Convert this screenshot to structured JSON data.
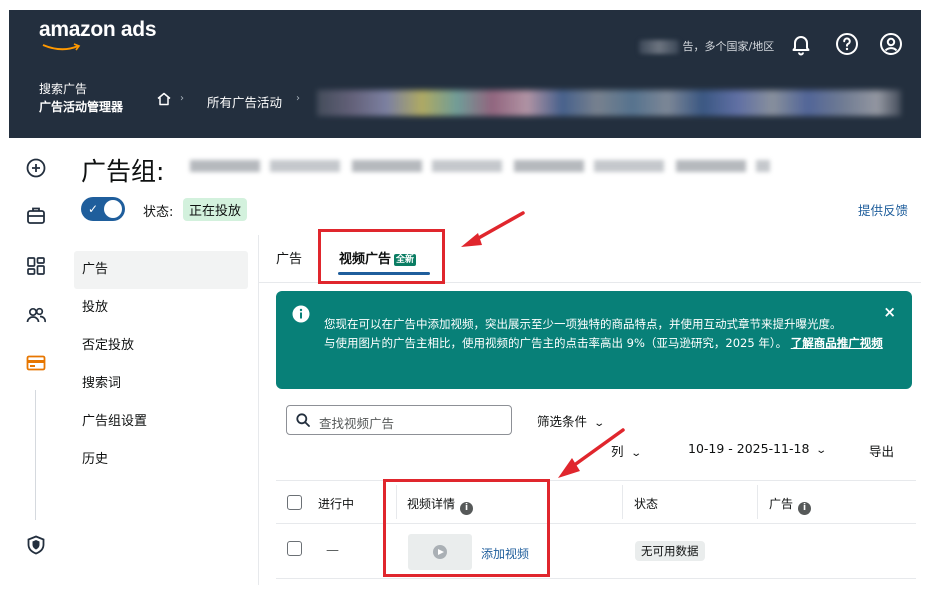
{
  "header": {
    "logo_text": "amazon ads",
    "account_text": "告，多个国家/地区",
    "breadcrumb_left_line1": "搜索广告",
    "breadcrumb_left_line2": "广告活动管理器",
    "breadcrumb_all_campaigns": "所有广告活动",
    "separator": "›",
    "icons": [
      "bell-icon",
      "help-icon",
      "user-icon",
      "home-icon"
    ]
  },
  "rail": {
    "icons": [
      "plus-circle-icon",
      "briefcase-icon",
      "dashboard-icon",
      "users-icon",
      "billing-card-icon",
      "shield-icon"
    ],
    "active_color": "#e77600"
  },
  "page": {
    "title": "广告组:",
    "status_label": "状态:",
    "status_value": "正在投放",
    "toggle_check": "✓",
    "feedback_link": "提供反馈"
  },
  "section_nav": {
    "items": [
      {
        "label": "广告",
        "active": true
      },
      {
        "label": "投放",
        "active": false
      },
      {
        "label": "否定投放",
        "active": false
      },
      {
        "label": "搜索词",
        "active": false
      },
      {
        "label": "广告组设置",
        "active": false
      },
      {
        "label": "历史",
        "active": false
      }
    ]
  },
  "tabs": {
    "ads": "广告",
    "video_ads": "视频广告",
    "new_badge": "全新"
  },
  "banner": {
    "text_line1": "您现在可以在广告中添加视频，突出展示至少一项独特的商品特点，并使用互动式章节来提升曝光度。",
    "text_line2": "与使用图片的广告主相比，使用视频的广告主的点击率高出 9%（亚马逊研究，2025 年）。",
    "link_text": "了解商品推广视频",
    "close": "×",
    "color": "#088078"
  },
  "toolbar": {
    "search_placeholder": "查找视频广告",
    "filter_label": "筛选条件",
    "columns_label": "列",
    "date_range": "10-19 - 2025-11-18",
    "export_label": "导出"
  },
  "table": {
    "headers": {
      "active": "进行中",
      "video_details": "视频详情",
      "status": "状态",
      "ads": "广告"
    },
    "row": {
      "active": "—",
      "add_video": "添加视频",
      "status": "无可用数据"
    }
  },
  "annotations": {
    "highlight_color": "#e0262d"
  }
}
